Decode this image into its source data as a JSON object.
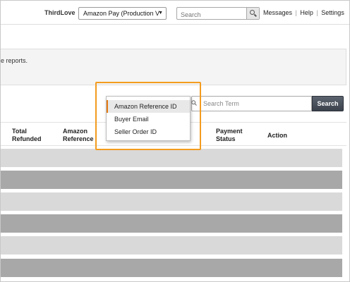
{
  "topbar": {
    "brand": "ThirdLove",
    "account_select": "Amazon Pay (Production V",
    "search_placeholder": "Search",
    "links": [
      "Messages",
      "Help",
      "Settings"
    ],
    "link_separator": "|"
  },
  "info_panel": {
    "text": "e reports."
  },
  "filters": {
    "options": [
      "Amazon Reference ID",
      "Buyer Email",
      "Seller Order ID"
    ],
    "selected_index": 0,
    "search_placeholder": "Search Term",
    "search_button": "Search"
  },
  "table": {
    "headers": [
      "Total Refunded",
      "Amazon Reference ID",
      "Payment Status",
      "Action"
    ],
    "header_lines": {
      "total_refunded": [
        "Total",
        "Refunded"
      ],
      "amazon_ref": [
        "Amazon",
        "Reference"
      ],
      "payment_status": [
        "Payment",
        "Status"
      ],
      "action": [
        "Action"
      ]
    },
    "rows": [
      "light",
      "dark",
      "light",
      "dark",
      "light",
      "dark"
    ]
  },
  "colors": {
    "highlight": "#f39c1f",
    "selected_accent": "#e47911",
    "search_button": "#3a414b"
  }
}
